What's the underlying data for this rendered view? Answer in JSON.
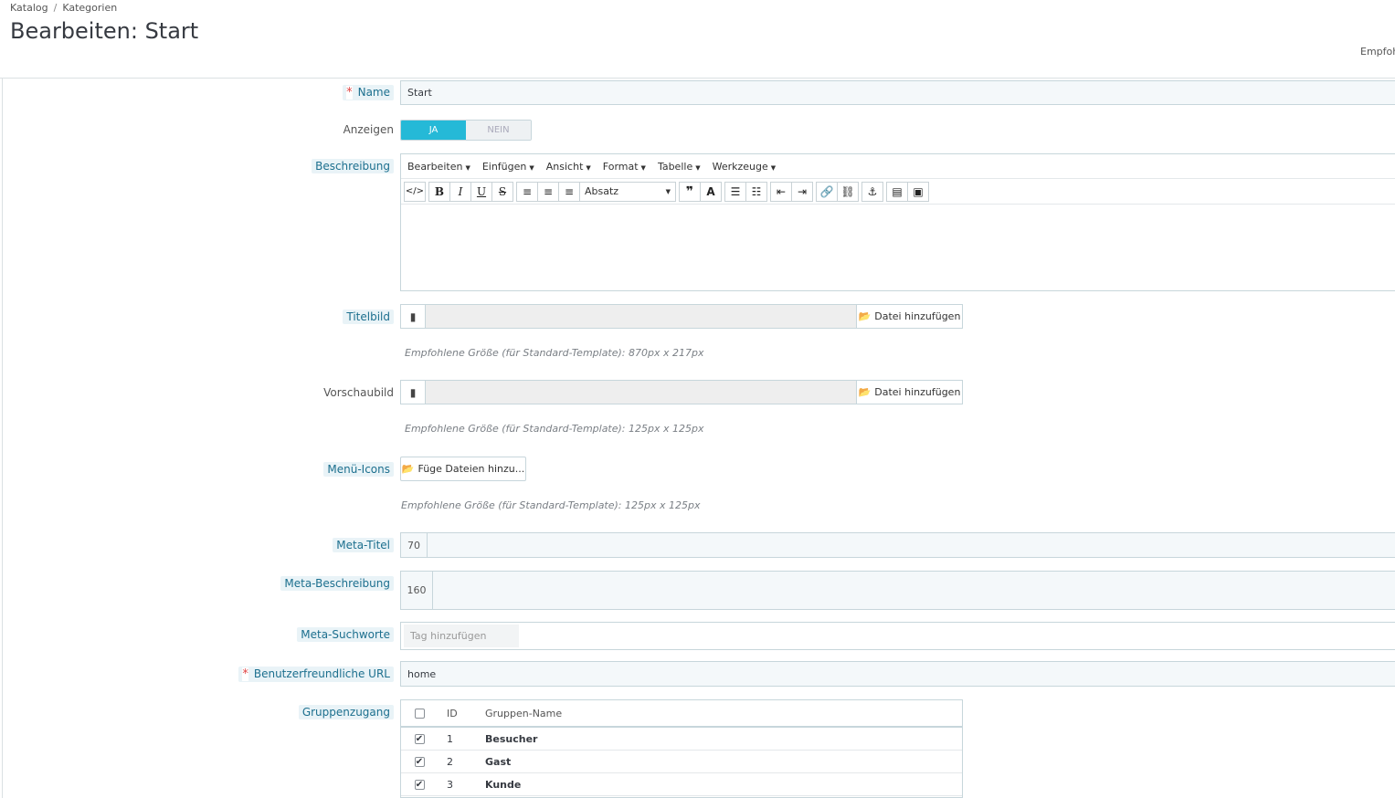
{
  "breadcrumb": {
    "root": "Katalog",
    "separator": "/",
    "current": "Kategorien"
  },
  "page_title": "Bearbeiten: Start",
  "header_right_text": "Empfoh",
  "colors": {
    "accent": "#25b9d7",
    "required": "#e04444",
    "hint_bg": "#e9f3f7"
  },
  "form": {
    "name": {
      "label": "Name",
      "required_mark": "*",
      "value": "Start"
    },
    "display": {
      "label": "Anzeigen",
      "yes": "JA",
      "no": "NEIN",
      "selected": "JA"
    },
    "description": {
      "label": "Beschreibung",
      "menus": [
        "Bearbeiten",
        "Einfügen",
        "Ansicht",
        "Format",
        "Tabelle",
        "Werkzeuge"
      ],
      "format_select": "Absatz"
    },
    "title_image": {
      "label": "Titelbild",
      "button": "Datei hinzufügen",
      "help": "Empfohlene Größe (für Standard-Template): 870px x 217px"
    },
    "preview_image": {
      "label": "Vorschaubild",
      "button": "Datei hinzufügen",
      "help": "Empfohlene Größe (für Standard-Template): 125px x 125px"
    },
    "menu_icons": {
      "label": "Menü-Icons",
      "button": "Füge Dateien hinzu...",
      "help": "Empfohlene Größe (für Standard-Template): 125px x 125px"
    },
    "meta_title": {
      "label": "Meta-Titel",
      "counter": "70",
      "value": ""
    },
    "meta_description": {
      "label": "Meta-Beschreibung",
      "counter": "160",
      "value": ""
    },
    "meta_keywords": {
      "label": "Meta-Suchworte",
      "placeholder": "Tag hinzufügen"
    },
    "friendly_url": {
      "label": "Benutzerfreundliche URL",
      "required_mark": "*",
      "value": "home"
    },
    "group_access": {
      "label": "Gruppenzugang",
      "columns": {
        "id": "ID",
        "name": "Gruppen-Name"
      },
      "rows": [
        {
          "checked": true,
          "id": "1",
          "name": "Besucher"
        },
        {
          "checked": true,
          "id": "2",
          "name": "Gast"
        },
        {
          "checked": true,
          "id": "3",
          "name": "Kunde"
        }
      ]
    }
  }
}
